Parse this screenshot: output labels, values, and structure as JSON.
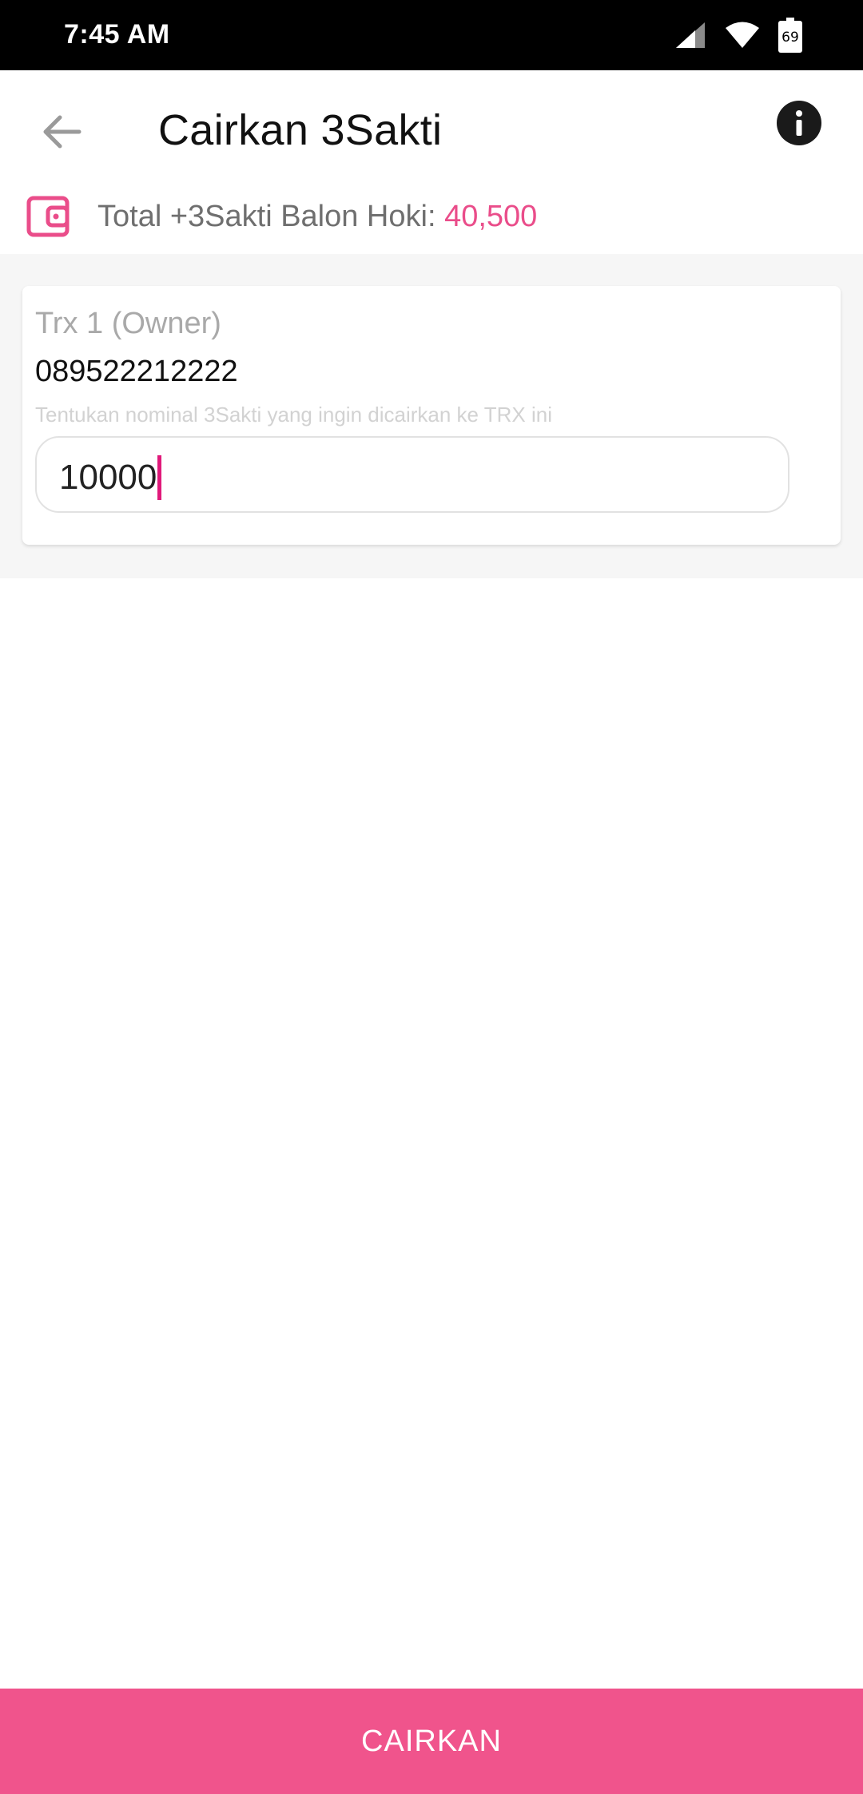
{
  "status_bar": {
    "time": "7:45 AM",
    "battery_level": "69",
    "icons": [
      "cellular-signal-icon",
      "wifi-icon",
      "battery-icon"
    ]
  },
  "app_bar": {
    "title": "Cairkan 3Sakti",
    "back_icon": "arrow-back-icon",
    "info_icon": "info-icon"
  },
  "balance": {
    "label": "Total +3Sakti Balon Hoki: ",
    "value": "40,500",
    "icon": "wallet-icon"
  },
  "trx_card": {
    "label": "Trx 1 (Owner)",
    "phone": "089522212222",
    "hint": "Tentukan nominal 3Sakti yang ingin dicairkan ke TRX ini",
    "amount_value": "10000"
  },
  "submit": {
    "label": "CAIRKAN"
  },
  "colors": {
    "accent": "#f0548c",
    "balance_value": "#ea4d8a",
    "caret": "#e0197a",
    "status_bar": "#000000"
  }
}
